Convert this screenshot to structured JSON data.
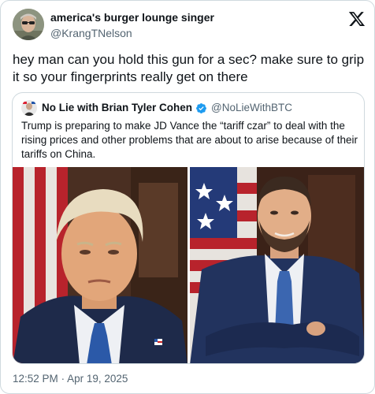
{
  "tweet": {
    "author": {
      "display_name": "america's burger lounge singer",
      "handle": "@KrangTNelson",
      "avatar_icon": "avatar-photo"
    },
    "text": "hey man can you hold this gun for a sec? make sure to grip it so your fingerprints really get on there",
    "quoted": {
      "author": {
        "display_name": "No Lie with Brian Tyler Cohen",
        "handle": "@NoLieWithBTC",
        "verified": true,
        "verified_color": "#1d9bf0"
      },
      "text": "Trump is preparing to make JD Vance the “tariff czar” to deal with the rising prices and other problems that are about to arise because of their tariffs on China.",
      "media": [
        {
          "description": "left-photo"
        },
        {
          "description": "right-photo"
        }
      ]
    },
    "timestamp": "12:52 PM",
    "separator": "·",
    "date": "Apr 19, 2025"
  },
  "brand": {
    "logo_icon": "x-logo-icon",
    "text_color": "#0f1419",
    "secondary_color": "#536471",
    "border_color": "#cfd9de"
  }
}
